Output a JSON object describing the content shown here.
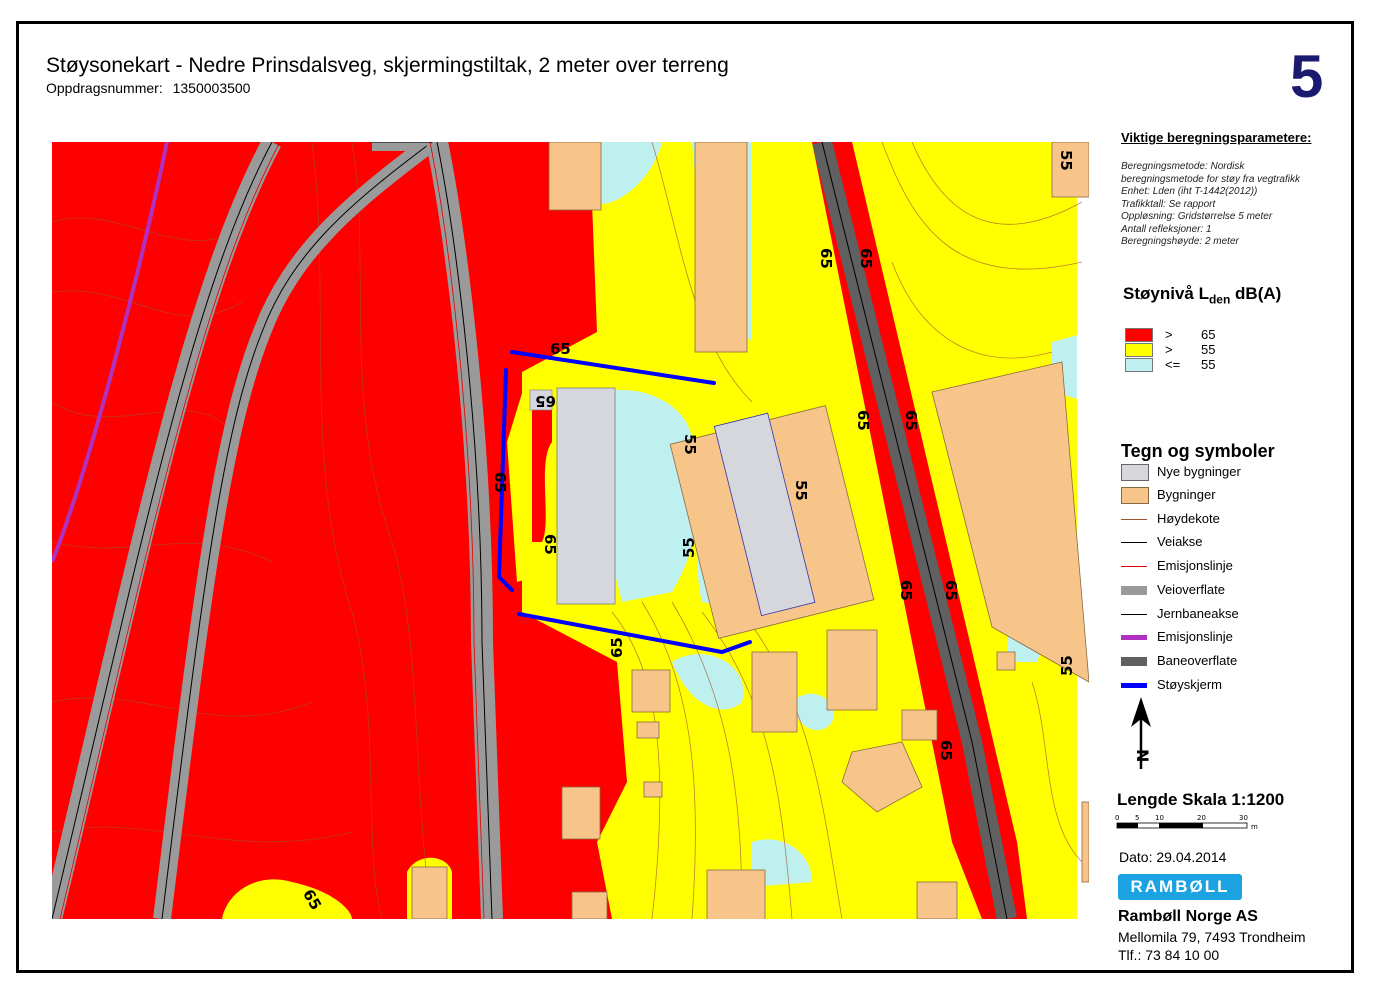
{
  "header": {
    "title": "Støysonekart - Nedre Prinsdalsveg, skjermingstiltak, 2 meter over terreng",
    "assignment_label": "Oppdragsnummer:",
    "assignment_number": "1350003500",
    "map_number": "5"
  },
  "parameters": {
    "title": "Viktige beregningsparametere:",
    "lines": [
      "Beregningsmetode: Nordisk",
      "beregningsmetode for støy fra vegtrafikk",
      "Enhet: Lden (iht T-1442(2012))",
      "Trafikktall: Se rapport",
      "Oppløsning: Gridstørrelse 5 meter",
      "Antall refleksjoner: 1",
      "Beregningshøyde: 2 meter"
    ]
  },
  "noise_legend": {
    "title_prefix": "Støynivå L",
    "title_sub": "den",
    "title_suffix": " dB(A)",
    "items": [
      {
        "op": ">",
        "value": "65",
        "color": "#ff0000"
      },
      {
        "op": ">",
        "value": "55",
        "color": "#ffff00"
      },
      {
        "op": "<=",
        "value": "55",
        "color": "#bff0f0"
      }
    ]
  },
  "symbols": {
    "title": "Tegn og symboler",
    "items": [
      {
        "label": "Nye bygninger",
        "kind": "box",
        "color": "#d6d6dd"
      },
      {
        "label": "Bygninger",
        "kind": "box",
        "color": "#f7c48a"
      },
      {
        "label": "Høydekote",
        "kind": "line",
        "color": "#a0522d"
      },
      {
        "label": "Veiakse",
        "kind": "line",
        "color": "#000000"
      },
      {
        "label": "Emisjonslinje",
        "kind": "line",
        "color": "#e00000"
      },
      {
        "label": "Veioverflate",
        "kind": "thick",
        "color": "#9a9a9a"
      },
      {
        "label": "Jernbaneakse",
        "kind": "line",
        "color": "#000000"
      },
      {
        "label": "Emisjonslinje",
        "kind": "thick",
        "color": "#b030c0"
      },
      {
        "label": "Baneoverflate",
        "kind": "thick",
        "color": "#606060"
      },
      {
        "label": "Støyskjerm",
        "kind": "thick",
        "color": "#0000ff"
      }
    ]
  },
  "north_letter": "N",
  "scale": {
    "title": "Lengde Skala 1:1200",
    "ticks": [
      "0",
      "5",
      "10",
      "20",
      "30"
    ],
    "unit": "m"
  },
  "date": "Dato: 29.04.2014",
  "company": {
    "logo_text": "RAMBØLL",
    "name": "Rambøll Norge AS",
    "address": "Mellomila 79, 7493 Trondheim",
    "phone": "Tlf.: 73 84 10 00"
  },
  "map_labels": [
    "65",
    "65",
    "65",
    "65",
    "55",
    "55",
    "55",
    "65",
    "65",
    "65",
    "65",
    "65",
    "55",
    "65",
    "65",
    "65",
    "55",
    "65"
  ]
}
